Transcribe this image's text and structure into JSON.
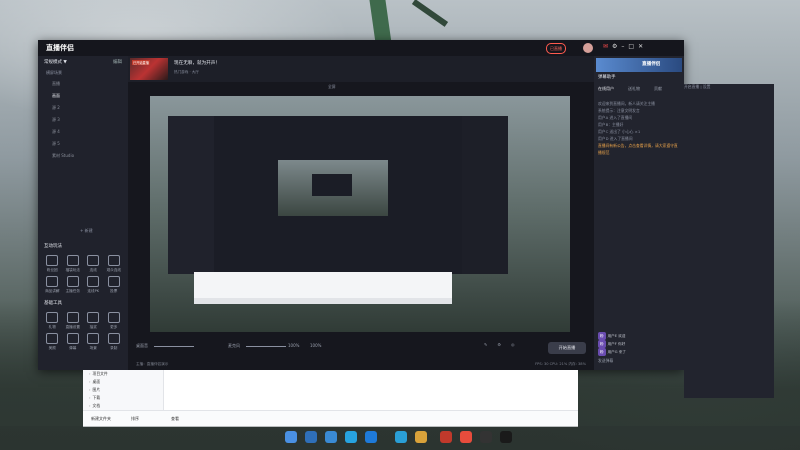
{
  "app": {
    "logo": "直播伴侣",
    "live_badge": "已直播",
    "topbar_icons": [
      "mail-icon",
      "settings-icon",
      "minimize-icon",
      "maximize-icon",
      "close-icon"
    ]
  },
  "left_panel": {
    "scene_header": "常规模式 ▼",
    "scene_header_right": "编辑",
    "scene_group": "横屏场景",
    "scenes": [
      "直播",
      "画面",
      "源 2",
      "源 3",
      "源 4",
      "源 5",
      "素材 Studio"
    ],
    "add_scene": "+ 新建",
    "interact_title": "互动玩法",
    "interact_items": [
      {
        "label": "粉丝团",
        "icon": "fans-icon"
      },
      {
        "label": "福袋玩法",
        "icon": "bag-icon"
      },
      {
        "label": "连线",
        "icon": "link-icon"
      },
      {
        "label": "观众连线",
        "icon": "viewer-link-icon"
      },
      {
        "label": "商品讲解",
        "icon": "download-icon"
      },
      {
        "label": "主播任务",
        "icon": "task-icon"
      },
      {
        "label": "连线PK",
        "icon": "pk-icon"
      },
      {
        "label": "投票",
        "icon": "vote-icon"
      }
    ],
    "tools_title": "基础工具",
    "tool_items": [
      {
        "label": "礼物",
        "icon": "gift-icon"
      },
      {
        "label": "直播设置",
        "icon": "live-settings-icon"
      },
      {
        "label": "抽奖",
        "icon": "lottery-icon"
      },
      {
        "label": "更多",
        "icon": "more-icon"
      },
      {
        "label": "美颜",
        "icon": "beauty-icon"
      },
      {
        "label": "弹幕",
        "icon": "danmaku-icon"
      },
      {
        "label": "场景",
        "icon": "scene-icon"
      },
      {
        "label": "录制",
        "icon": "record-icon"
      }
    ]
  },
  "center": {
    "thumb_label": "已开始直播",
    "room_title": "现在无聊，就为开声！",
    "room_sub": "热门游戏 · 大厅",
    "bar_mid": "全屏",
    "bar_right": "开启直播 | 设置",
    "volume_label": "桌面音",
    "volume_value": "100%",
    "mic_label": "麦克风",
    "mic_value": "100%",
    "start_button": "开始直播",
    "status_left": "主播：直播伴侣演示",
    "status_right": "FPS: 30  CPU: 21%  内存: 38%"
  },
  "right_panel": {
    "banner_text": "直播伴侣",
    "title": "弹幕助手",
    "tabs": [
      "在线用户",
      "送礼物",
      "贡献"
    ],
    "messages": [
      "欢迎来到直播间，新人请关注主播",
      "系统提示：注意文明发言",
      "用户A 进入了直播间",
      "用户B：主播好",
      "用户C 送出了 小心心 ×1",
      "用户D 进入了直播间"
    ],
    "notice": "直播间有新公告，点击查看详情，请大家遵守直播规范",
    "users": [
      {
        "tag": "粉",
        "name": "用户E 欢迎"
      },
      {
        "tag": "粉",
        "name": "用户F 你好"
      },
      {
        "tag": "粉",
        "name": "用户G 来了"
      }
    ],
    "send": "发送弹幕"
  },
  "explorer": {
    "tree": [
      "项目文件",
      "桌面",
      "图片",
      "下载",
      "文档"
    ],
    "footer_items": [
      "新建文件夹",
      "排序",
      "查看"
    ]
  }
}
